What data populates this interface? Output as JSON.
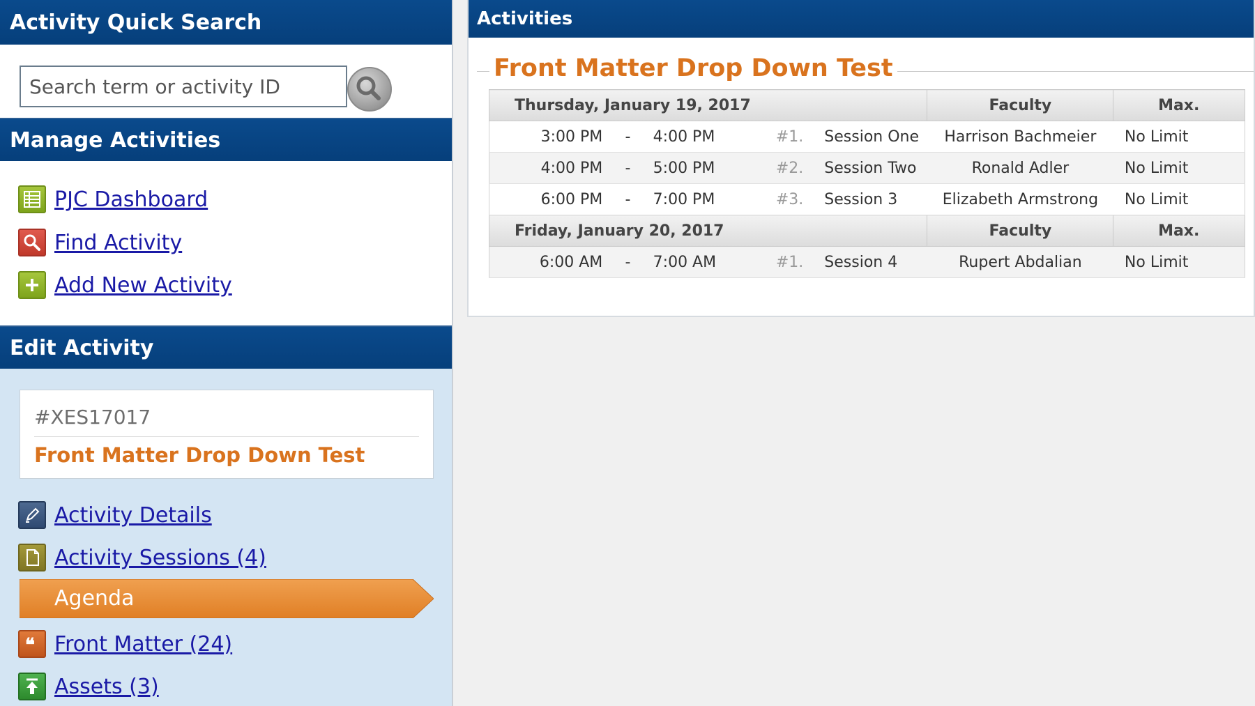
{
  "quick_search": {
    "header": "Activity Quick Search",
    "placeholder": "Search term or activity ID",
    "button_icon": "magnifier-icon"
  },
  "manage": {
    "header": "Manage Activities",
    "links": [
      {
        "label": "PJC Dashboard",
        "icon": "table-icon"
      },
      {
        "label": "Find Activity",
        "icon": "magnifier-icon"
      },
      {
        "label": "Add New Activity",
        "icon": "plus-icon"
      }
    ]
  },
  "edit": {
    "header": "Edit Activity",
    "activity_id": "#XES17017",
    "activity_title": "Front Matter Drop Down Test",
    "links": [
      {
        "label": "Activity Details",
        "icon": "pencil-icon"
      },
      {
        "label": "Activity Sessions (4)",
        "icon": "document-icon"
      },
      {
        "label": "Agenda",
        "active": true
      },
      {
        "label": "Front Matter (24)",
        "icon": "quote-icon"
      },
      {
        "label": "Assets (3)",
        "icon": "upload-icon"
      }
    ],
    "active_color": "#e8913c"
  },
  "activities": {
    "header": "Activities",
    "title": "Front Matter Drop Down Test",
    "faculty_header": "Faculty",
    "max_header": "Max.",
    "days": [
      {
        "date": "Thursday, January 19, 2017",
        "sessions": [
          {
            "start": "3:00 PM",
            "sep": "-",
            "end": "4:00 PM",
            "num": "#1.",
            "name": "Session One",
            "faculty": "Harrison Bachmeier",
            "max": "No Limit"
          },
          {
            "start": "4:00 PM",
            "sep": "-",
            "end": "5:00 PM",
            "num": "#2.",
            "name": "Session Two",
            "faculty": "Ronald Adler",
            "max": "No Limit"
          },
          {
            "start": "6:00 PM",
            "sep": "-",
            "end": "7:00 PM",
            "num": "#3.",
            "name": "Session 3",
            "faculty": "Elizabeth Armstrong",
            "max": "No Limit"
          }
        ]
      },
      {
        "date": "Friday, January 20, 2017",
        "sessions": [
          {
            "start": "6:00 AM",
            "sep": "-",
            "end": "7:00 AM",
            "num": "#1.",
            "name": "Session 4",
            "faculty": "Rupert Abdalian",
            "max": "No Limit"
          }
        ]
      }
    ]
  },
  "colors": {
    "header_blue": "#063f7b",
    "accent_orange": "#d9731e",
    "sidebar_bg": "#d4e5f3",
    "link_blue": "#1a1aa6"
  }
}
